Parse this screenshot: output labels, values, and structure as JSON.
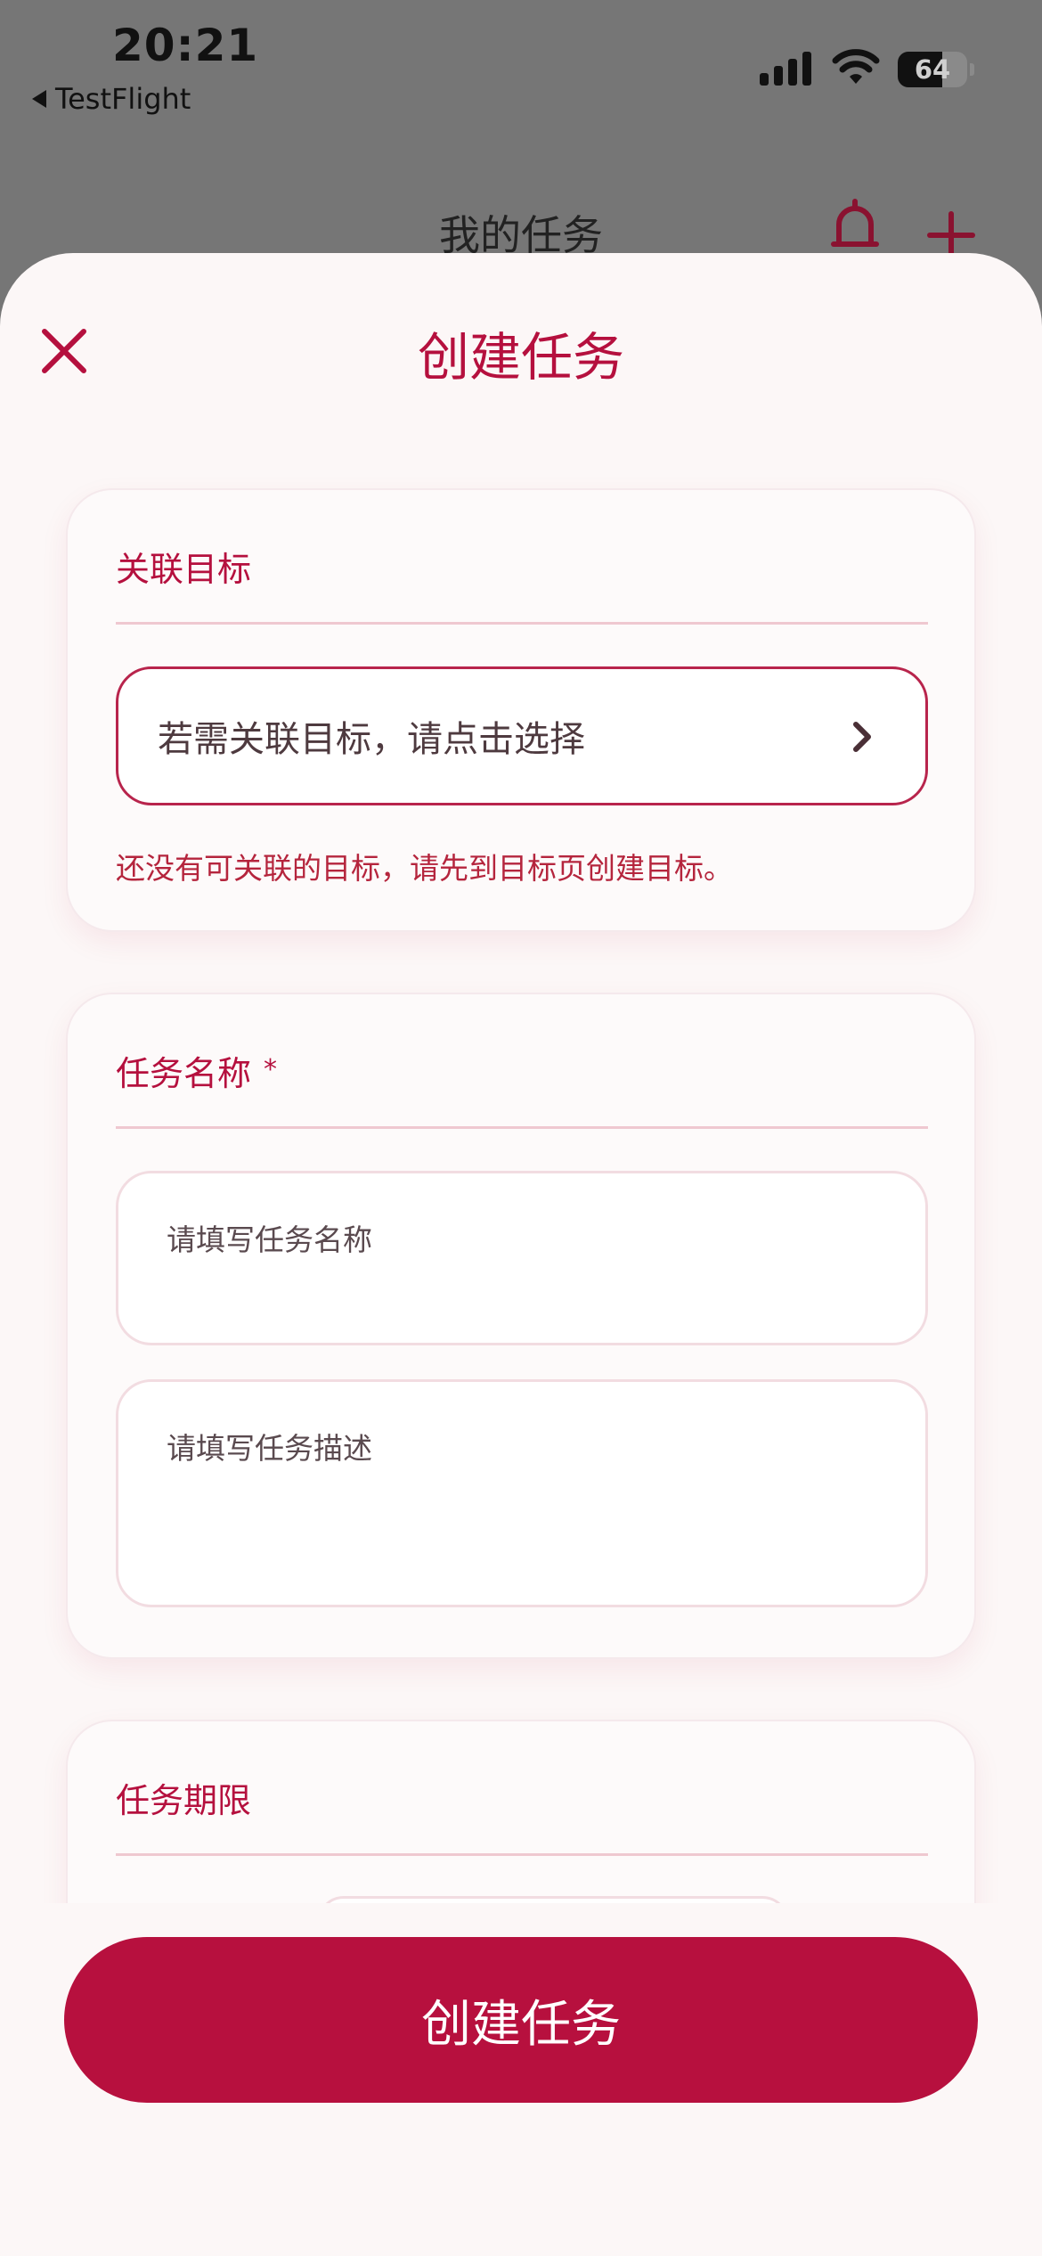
{
  "status_bar": {
    "time": "20:21",
    "back_app": "TestFlight",
    "battery": "64",
    "battery_level": 0.64
  },
  "background_nav": {
    "title": "我的任务"
  },
  "sheet": {
    "title": "创建任务",
    "goal_card": {
      "label": "关联目标",
      "select_placeholder": "若需关联目标，请点击选择",
      "hint": "还没有可关联的目标，请先到目标页创建目标。"
    },
    "name_card": {
      "label": "任务名称",
      "required_mark": "*",
      "name_placeholder": "请填写任务名称",
      "description_placeholder": "请填写任务描述"
    },
    "deadline_card": {
      "label": "任务期限"
    },
    "submit_label": "创建任务"
  },
  "colors": {
    "accent": "#b5103e",
    "sheet_bg": "#fcf7f7",
    "overlay": "#767676"
  },
  "icons": [
    "close-icon",
    "chevron-right-icon",
    "bell-icon",
    "plus-icon",
    "back-arrow-icon",
    "signal-icon",
    "wifi-icon",
    "battery-icon"
  ]
}
